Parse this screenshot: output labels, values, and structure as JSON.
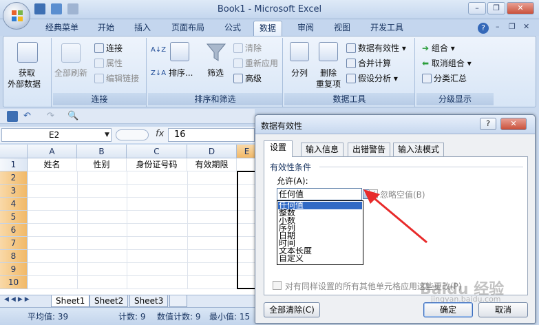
{
  "app": {
    "title": "Book1 - Microsoft Excel",
    "min": "–",
    "restore": "❐",
    "close": "✕"
  },
  "tabs": [
    "经典菜单",
    "开始",
    "插入",
    "页面布局",
    "公式",
    "数据",
    "审阅",
    "视图",
    "开发工具"
  ],
  "ribbon": {
    "get_external_line1": "获取",
    "get_external_line2": "外部数据",
    "refresh_all": "全部刷新",
    "connections": "连接",
    "properties": "属性",
    "edit_links": "编辑链接",
    "group_connections": "连接",
    "sort": "排序...",
    "filter": "筛选",
    "clear": "清除",
    "reapply": "重新应用",
    "advanced": "高级",
    "group_sort_filter": "排序和筛选",
    "split": "分列",
    "remove_dup_line1": "删除",
    "remove_dup_line2": "重复项",
    "data_validation": "数据有效性",
    "consolidate": "合并计算",
    "what_if": "假设分析",
    "group_data_tools": "数据工具",
    "group": "组合",
    "ungroup": "取消组合",
    "subtotal": "分类汇总",
    "group_outline": "分级显示",
    "sort_az": "A↓Z",
    "sort_za": "Z↓A"
  },
  "formula_bar": {
    "name_box": "E2",
    "fx": "fx",
    "value": "16"
  },
  "sheet": {
    "columns": [
      "A",
      "B",
      "C",
      "D",
      "E"
    ],
    "rows": [
      "1",
      "2",
      "3",
      "4",
      "5",
      "6",
      "7",
      "8",
      "9",
      "10"
    ],
    "headers": [
      "姓名",
      "性别",
      "身份证号码",
      "有效期限"
    ]
  },
  "sheet_tabs": [
    "Sheet1",
    "Sheet2",
    "Sheet3"
  ],
  "status": {
    "average": "平均值: 39",
    "count": "计数: 9",
    "numeric_count": "数值计数: 9",
    "min": "最小值: 15"
  },
  "dialog": {
    "title": "数据有效性",
    "help": "?",
    "close": "✕",
    "tabs": [
      "设置",
      "输入信息",
      "出错警告",
      "输入法模式"
    ],
    "group_title": "有效性条件",
    "allow_label": "允许(A):",
    "allow_value": "任何值",
    "ignore_blank": "忽略空值(B)",
    "options": [
      "任何值",
      "整数",
      "小数",
      "序列",
      "日期",
      "时间",
      "文本长度",
      "自定义"
    ],
    "apply_all": "对有同样设置的所有其他单元格应用这些更改(P)",
    "clear_all": "全部清除(C)",
    "ok": "确定",
    "cancel": "取消"
  },
  "watermark": {
    "text": "Baidu 经验",
    "sub": "jingyan.baidu.com"
  }
}
